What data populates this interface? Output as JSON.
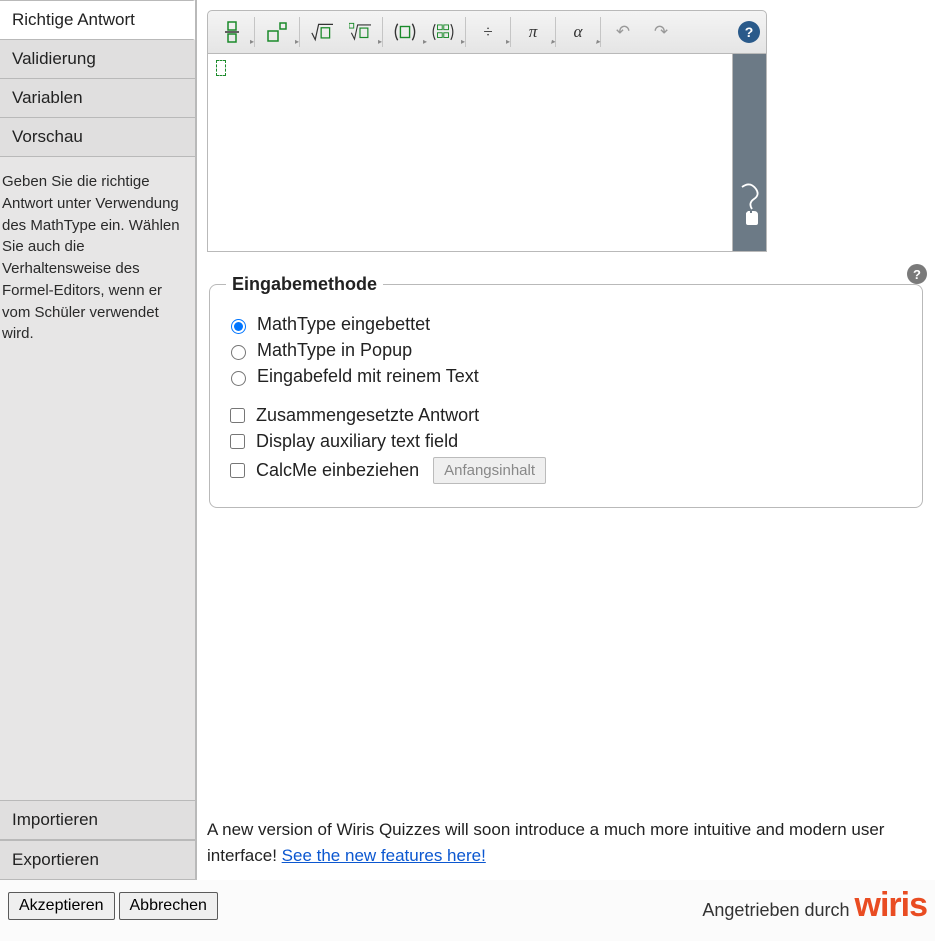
{
  "sidebar": {
    "tabs": [
      {
        "label": "Richtige Antwort",
        "active": true
      },
      {
        "label": "Validierung"
      },
      {
        "label": "Variablen"
      },
      {
        "label": "Vorschau"
      }
    ],
    "help_text": "Geben Sie die richtige Antwort unter Verwendung des MathType ein. Wählen Sie auch die Verhaltensweise des Formel-Editors, wenn er vom Schüler verwendet wird.",
    "bottom": [
      {
        "label": "Importieren"
      },
      {
        "label": "Exportieren"
      }
    ]
  },
  "toolbar": {
    "buttons": [
      {
        "name": "fraction",
        "title": "Bruch"
      },
      {
        "name": "superscript",
        "title": "Exponent"
      },
      {
        "name": "sqrt",
        "title": "Quadratwurzel"
      },
      {
        "name": "nroot",
        "title": "n-te Wurzel"
      },
      {
        "name": "parentheses",
        "title": "Klammern"
      },
      {
        "name": "matrix",
        "title": "Matrix"
      },
      {
        "name": "division",
        "title": "Division",
        "glyph": "÷"
      },
      {
        "name": "pi",
        "title": "Pi",
        "glyph": "π"
      },
      {
        "name": "alpha",
        "title": "Alpha",
        "glyph": "α"
      },
      {
        "name": "undo",
        "title": "Rückgängig",
        "glyph": "↶"
      },
      {
        "name": "redo",
        "title": "Wiederholen",
        "glyph": "↷"
      }
    ],
    "help_glyph": "?"
  },
  "input_method": {
    "legend": "Eingabemethode",
    "help_glyph": "?",
    "radios": [
      {
        "label": "MathType eingebettet",
        "checked": true
      },
      {
        "label": "MathType in Popup"
      },
      {
        "label": "Eingabefeld mit reinem Text"
      }
    ],
    "checks": [
      {
        "label": "Zusammengesetzte Antwort"
      },
      {
        "label": "Display auxiliary text field"
      },
      {
        "label": "CalcMe einbeziehen",
        "extra_button": "Anfangsinhalt"
      }
    ]
  },
  "notice": {
    "text": "A new version of Wiris Quizzes will soon introduce a much more intuitive and modern user interface! ",
    "link_text": "See the new features here!"
  },
  "footer": {
    "accept": "Akzeptieren",
    "cancel": "Abbrechen",
    "powered": "Angetrieben durch",
    "brand": "wiris"
  }
}
